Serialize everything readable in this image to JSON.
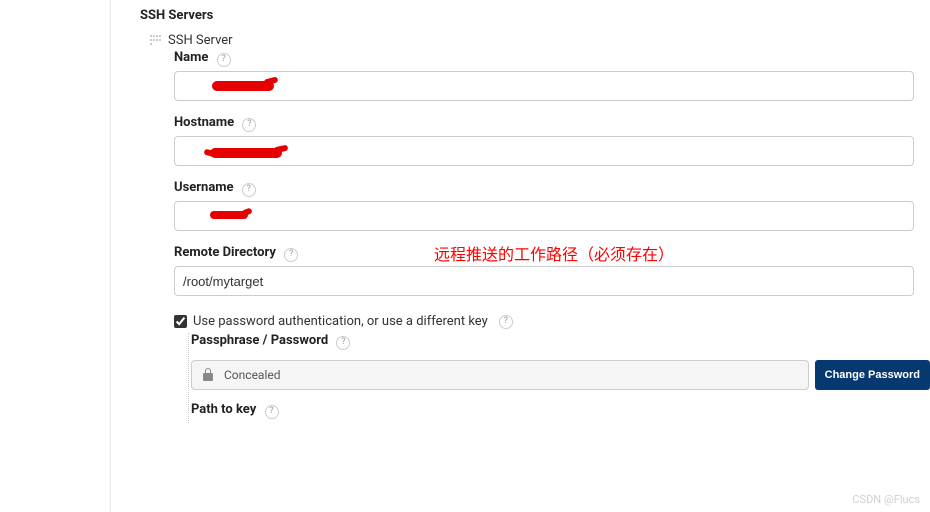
{
  "section": {
    "title": "SSH Servers",
    "server_label": "SSH Server"
  },
  "fields": {
    "name": {
      "label": "Name",
      "value": ""
    },
    "hostname": {
      "label": "Hostname",
      "value": ""
    },
    "username": {
      "label": "Username",
      "value": ""
    },
    "remote_directory": {
      "label": "Remote Directory",
      "value": "/root/mytarget"
    },
    "path_to_key": {
      "label": "Path to key"
    }
  },
  "auth": {
    "checkbox_label": "Use password authentication, or use a different key",
    "checked": true,
    "passphrase_label": "Passphrase / Password",
    "concealed_text": "Concealed",
    "change_button": "Change Password"
  },
  "annotation": "远程推送的工作路径（必须存在）",
  "help_glyph": "?",
  "watermark": "CSDN @Flucs"
}
